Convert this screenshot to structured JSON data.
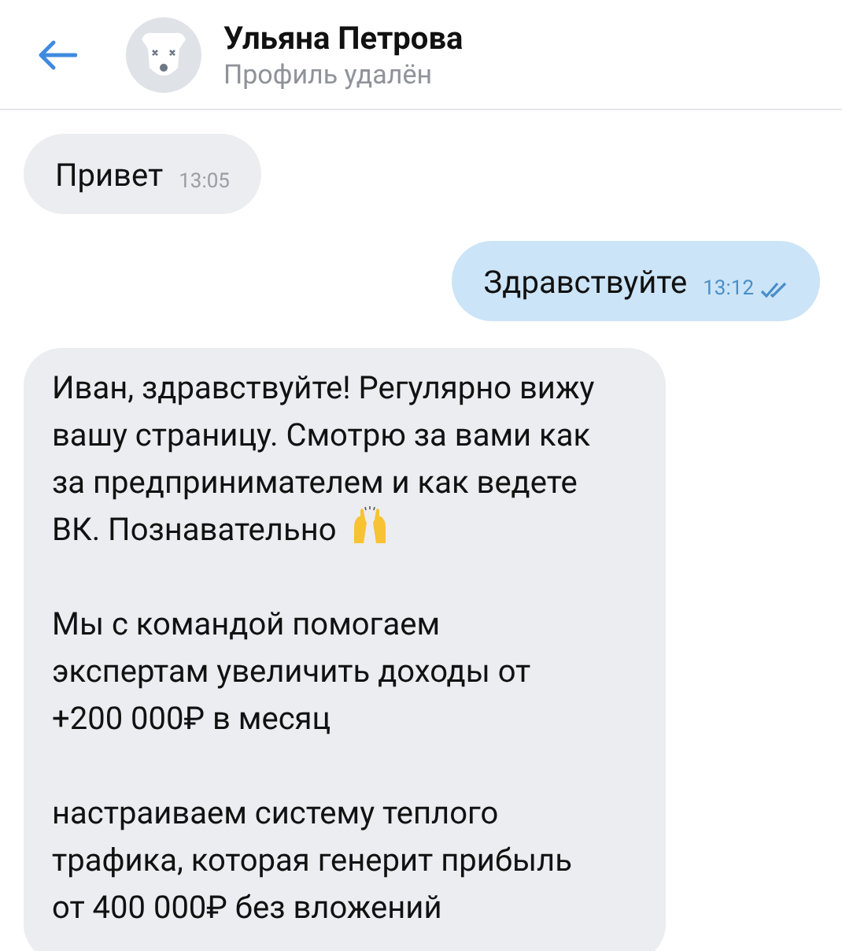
{
  "header": {
    "name": "Ульяна Петрова",
    "status": "Профиль удалён"
  },
  "messages": [
    {
      "kind": "incoming",
      "paragraphs": [
        "Привет"
      ],
      "time": "13:05"
    },
    {
      "kind": "outgoing",
      "paragraphs": [
        "Здравствуйте"
      ],
      "time": "13:12",
      "read": true
    },
    {
      "kind": "incoming",
      "paragraphs": [
        "Иван, здравствуйте! Регулярно вижу\nвашу страницу. Смотрю за вами как\nза предпринимателем и как ведете\nВК. Познавательно",
        "Мы с командой помогаем\nэкспертам увеличить доходы от\n+200 000₽ в месяц",
        "настраиваем систему теплого\nтрафика, которая генерит прибыль\nот 400 000₽ без вложений"
      ],
      "emoji_after_first": true
    }
  ]
}
